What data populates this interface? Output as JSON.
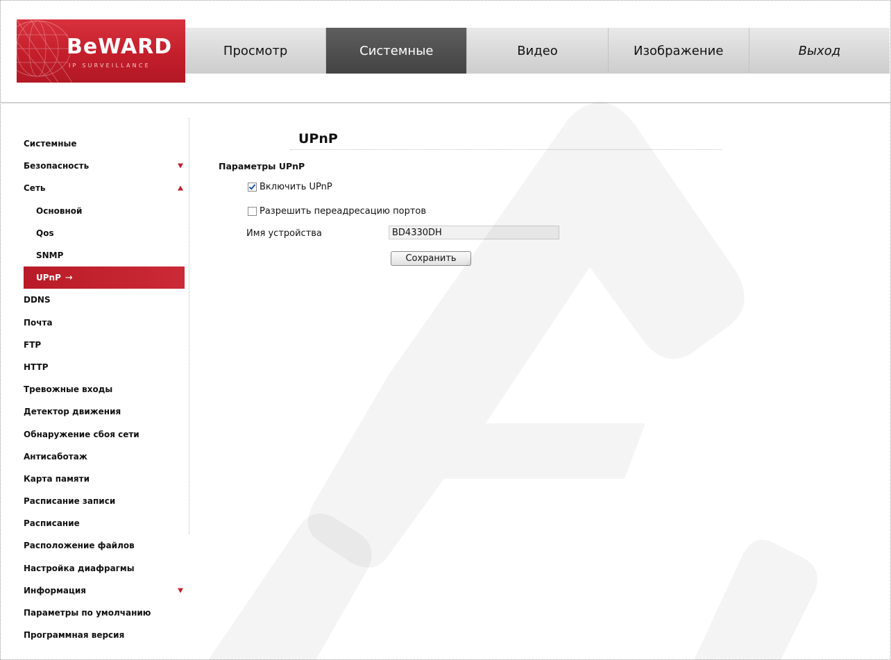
{
  "brand": {
    "logo_text": "BeWARD",
    "logo_subtext": "IP SURVEILLANCE"
  },
  "nav": {
    "tabs": [
      {
        "label": "Просмотр"
      },
      {
        "label": "Системные",
        "active": true
      },
      {
        "label": "Видео"
      },
      {
        "label": "Изображение"
      },
      {
        "label": "Выход"
      }
    ]
  },
  "sidebar": {
    "items": [
      {
        "label": "Системные"
      },
      {
        "label": "Безопасность",
        "indicator": "triangle-down-icon"
      },
      {
        "label": "Сеть",
        "indicator": "triangle-up-icon"
      },
      {
        "label": "Основной",
        "sub": true
      },
      {
        "label": "Qos",
        "sub": true
      },
      {
        "label": "SNMP",
        "sub": true
      },
      {
        "label": "UPnP",
        "sub": true,
        "active": true,
        "indicator": "arrow-right-icon",
        "arrow": "→"
      },
      {
        "label": "DDNS"
      },
      {
        "label": "Почта"
      },
      {
        "label": "FTP"
      },
      {
        "label": "HTTP"
      },
      {
        "label": "Тревожные входы"
      },
      {
        "label": "Детектор движения"
      },
      {
        "label": "Обнаружение сбоя сети"
      },
      {
        "label": "Антисаботаж"
      },
      {
        "label": "Карта памяти"
      },
      {
        "label": "Расписание записи"
      },
      {
        "label": "Расписание"
      },
      {
        "label": "Расположение файлов"
      },
      {
        "label": "Настройка диафрагмы"
      },
      {
        "label": "Информация",
        "indicator": "triangle-down-icon"
      },
      {
        "label": "Параметры по умолчанию"
      },
      {
        "label": "Программная версия"
      }
    ]
  },
  "main": {
    "title": "UPnP",
    "section_title": "Параметры UPnP",
    "enable_upnp": {
      "label": "Включить UPnP",
      "checked": true
    },
    "port_forwarding": {
      "label": "Разрешить переадресацию портов",
      "checked": false
    },
    "device_name": {
      "label": "Имя устройства",
      "value": "BD4330DH"
    },
    "save_label": "Сохранить"
  },
  "colors": {
    "accent": "#c41e2b",
    "nav_active": "#4a4a4a",
    "nav_bg": "#dadada"
  }
}
